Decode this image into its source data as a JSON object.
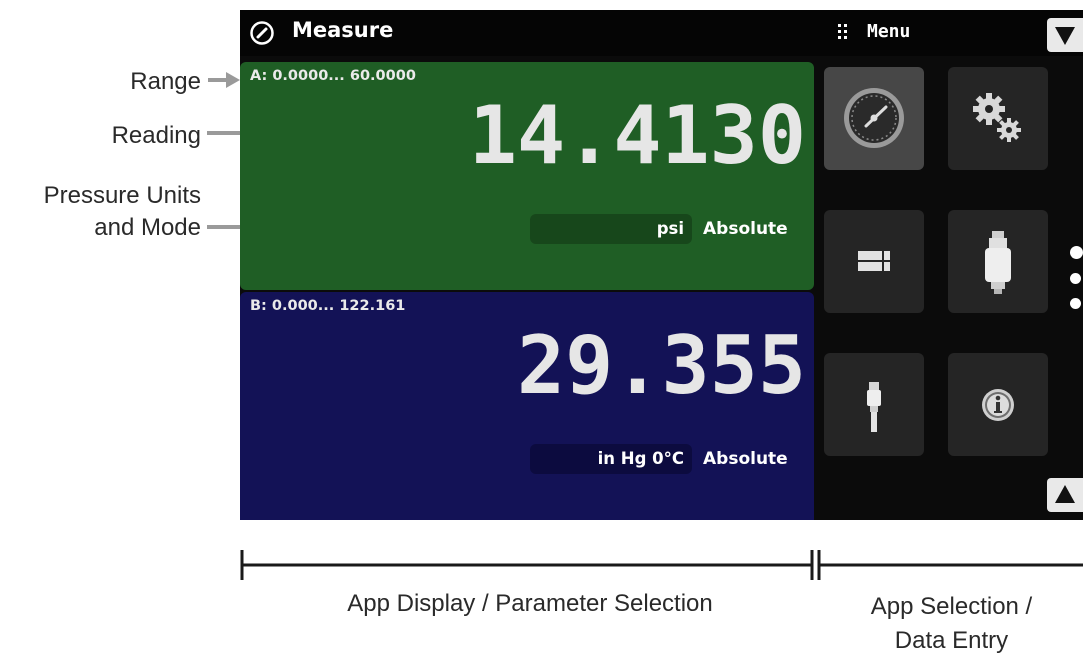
{
  "annotations": {
    "range_label": "Range",
    "reading_label": "Reading",
    "units_label_line1": "Pressure Units",
    "units_label_line2": "and Mode"
  },
  "header": {
    "title": "Measure",
    "title_icon": "gauge-icon",
    "menu_label": "Menu",
    "menu_icon": "grip-dots-icon"
  },
  "channel_a": {
    "range": "A:  0.0000... 60.0000",
    "reading": "14.4130",
    "units": "psi",
    "mode": "Absolute",
    "color": "#1f5e25"
  },
  "channel_b": {
    "range": "B:   0.000... 122.161",
    "reading": "29.355",
    "units": "in Hg 0°C",
    "mode": "Absolute",
    "color": "#131256"
  },
  "apps": [
    {
      "name": "measure-app",
      "icon": "gauge-icon",
      "active": true
    },
    {
      "name": "settings-app",
      "icon": "gears-icon",
      "active": false
    },
    {
      "name": "display-layout-app",
      "icon": "layout-icon",
      "active": false
    },
    {
      "name": "sensor-app",
      "icon": "transducer-icon",
      "active": false
    },
    {
      "name": "probe-app",
      "icon": "probe-icon",
      "active": false
    },
    {
      "name": "info-app",
      "icon": "info-icon",
      "active": false
    }
  ],
  "page_indicator": {
    "pages": 3,
    "current": 1
  },
  "captions": {
    "left_line1": "App Display / Parameter Selection",
    "right_line1": "App Selection /",
    "right_line2": "Data Entry"
  }
}
